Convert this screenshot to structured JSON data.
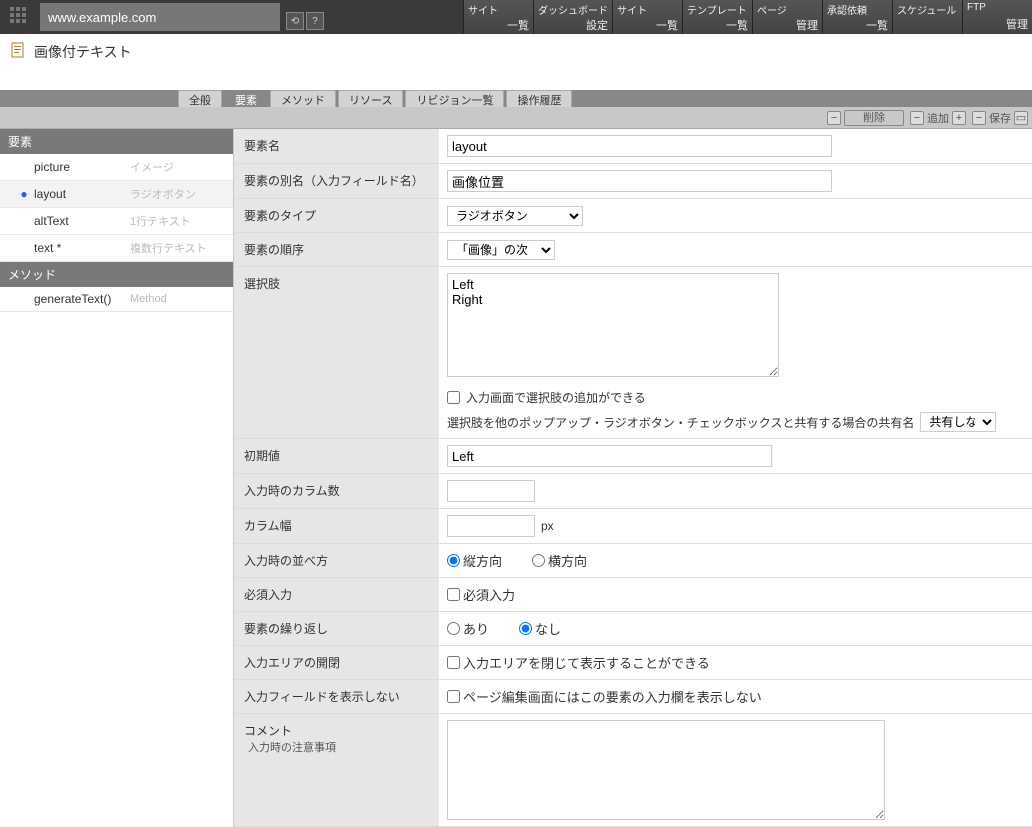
{
  "topbar": {
    "url": "www.example.com",
    "nav": [
      {
        "label": "サイト",
        "sub": "一覧"
      },
      {
        "label": "ダッシュボード",
        "sub": "設定"
      },
      {
        "label": "サイト",
        "sub": "一覧"
      },
      {
        "label": "テンプレート",
        "sub": "一覧"
      },
      {
        "label": "ページ",
        "sub": "管理"
      },
      {
        "label": "承認依頼",
        "sub": "一覧"
      },
      {
        "label": "スケジュール",
        "sub": ""
      },
      {
        "label": "FTP",
        "sub": "管理"
      }
    ]
  },
  "page": {
    "title": "画像付テキスト"
  },
  "tabs": [
    {
      "label": "全般",
      "active": false
    },
    {
      "label": "要素",
      "active": true
    },
    {
      "label": "メソッド",
      "active": false
    },
    {
      "label": "リソース",
      "active": false
    },
    {
      "label": "リビジョン一覧",
      "active": false
    },
    {
      "label": "操作履歴",
      "active": false
    }
  ],
  "toolbar": {
    "delete": "削除",
    "add": "追加",
    "save": "保存"
  },
  "sidebar": {
    "group_elements": "要素",
    "group_methods": "メソッド",
    "elements": [
      {
        "name": "picture",
        "type": "イメージ",
        "selected": false,
        "required": false
      },
      {
        "name": "layout",
        "type": "ラジオボタン",
        "selected": true,
        "required": false
      },
      {
        "name": "altText",
        "type": "1行テキスト",
        "selected": false,
        "required": false
      },
      {
        "name": "text *",
        "type": "複数行テキスト",
        "selected": false,
        "required": true
      }
    ],
    "methods": [
      {
        "name": "generateText()",
        "type": "Method"
      }
    ]
  },
  "form": {
    "labels": {
      "name": "要素名",
      "alias": "要素の別名（入力フィールド名）",
      "type": "要素のタイプ",
      "order": "要素の順序",
      "options": "選択肢",
      "options_addable": "入力画面で選択肢の追加ができる",
      "share_note": "選択肢を他のポップアップ・ラジオボタン・チェックボックスと共有する場合の共有名",
      "share_select": "共有しない",
      "default": "初期値",
      "columns": "入力時のカラム数",
      "colwidth": "カラム幅",
      "colwidth_unit": "px",
      "layoutdir": "入力時の並べ方",
      "layout_v": "縦方向",
      "layout_h": "横方向",
      "required": "必須入力",
      "required_chk": "必須入力",
      "repeat": "要素の繰り返し",
      "repeat_yes": "あり",
      "repeat_no": "なし",
      "collapse": "入力エリアの開閉",
      "collapse_chk": "入力エリアを閉じて表示することができる",
      "hidefield": "入力フィールドを表示しない",
      "hidefield_chk": "ページ編集画面にはこの要素の入力欄を表示しない",
      "comment": "コメント",
      "comment_sub": "入力時の注意事項"
    },
    "values": {
      "name": "layout",
      "alias": "画像位置",
      "type": "ラジオボタン",
      "order": "「画像」の次",
      "options": "Left\nRight",
      "default": "Left",
      "columns": "",
      "colwidth": "",
      "layoutdir": "v",
      "required": false,
      "repeat": "no",
      "collapse": false,
      "hidefield": false,
      "comment": ""
    }
  }
}
